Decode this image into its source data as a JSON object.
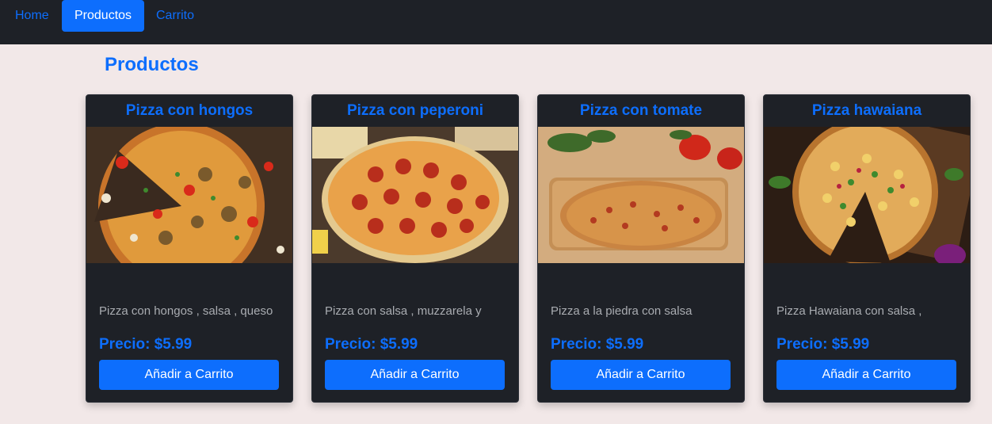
{
  "nav": {
    "home": "Home",
    "productos": "Productos",
    "carrito": "Carrito"
  },
  "page": {
    "title": "Productos"
  },
  "products": [
    {
      "title": "Pizza con hongos",
      "description": "Pizza con hongos , salsa , queso",
      "price": "Precio: $5.99",
      "button": "Añadir a Carrito",
      "image": "pizza-with-mushrooms-photo"
    },
    {
      "title": "Pizza con peperoni",
      "description": "Pizza con salsa , muzzarela y",
      "price": "Precio: $5.99",
      "button": "Añadir a Carrito",
      "image": "pizza-with-pepperoni-photo"
    },
    {
      "title": "Pizza con tomate",
      "description": "Pizza a la piedra con salsa",
      "price": "Precio: $5.99",
      "button": "Añadir a Carrito",
      "image": "pizza-with-tomato-photo"
    },
    {
      "title": "Pizza hawaiana",
      "description": "Pizza Hawaiana con salsa ,",
      "price": "Precio: $5.99",
      "button": "Añadir a Carrito",
      "image": "hawaiian-pizza-photo"
    }
  ],
  "colors": {
    "accent": "#0d6efd",
    "navbar_bg": "#1e2127",
    "page_bg": "#f2e8e8",
    "card_bg": "#1e2127",
    "desc_text": "#a9acb1"
  }
}
